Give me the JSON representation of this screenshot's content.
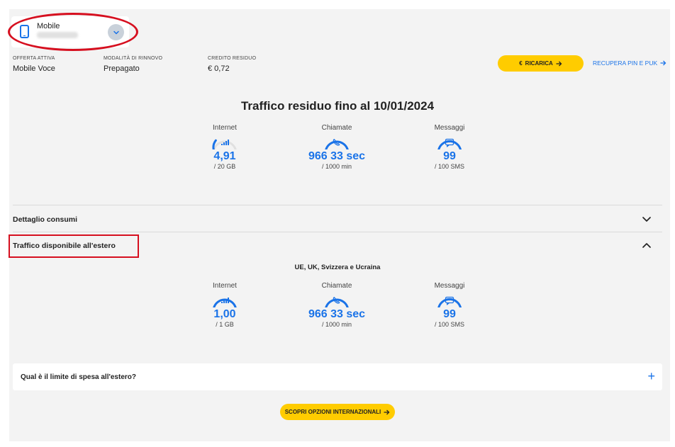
{
  "device": {
    "label": "Mobile",
    "icon": "smartphone-icon",
    "chevron_icon": "chevron-down-icon"
  },
  "summary": {
    "offer_label": "OFFERTA ATTIVA",
    "offer_value": "Mobile Voce",
    "renewal_label": "MODALITÀ DI RINNOVO",
    "renewal_value": "Prepagato",
    "credit_label": "CREDITO RESIDUO",
    "credit_value": "€ 0,72"
  },
  "actions": {
    "recharge_label": "RICARICA",
    "recharge_icon": "euro-icon",
    "recover_label": "RECUPERA PIN E PUK",
    "arrow_icon": "arrow-right-icon"
  },
  "traffic": {
    "title": "Traffico residuo fino al 10/01/2024",
    "meters": [
      {
        "label": "Internet",
        "value": "4,91",
        "unit": "/ 20 GB",
        "icon": "signal-bars-icon",
        "fraction": 0.25
      },
      {
        "label": "Chiamate",
        "value": "966 33 sec",
        "unit": "/ 1000 min",
        "icon": "phone-icon",
        "fraction": 1.0
      },
      {
        "label": "Messaggi",
        "value": "99",
        "unit": "/ 100 SMS",
        "icon": "message-icon",
        "fraction": 0.99
      }
    ]
  },
  "accordion": {
    "details_title": "Dettaglio consumi",
    "abroad_title": "Traffico disponibile all'estero",
    "collapsed_icon": "chevron-down-icon",
    "expanded_icon": "chevron-up-icon"
  },
  "abroad": {
    "region": "UE, UK, Svizzera e Ucraina",
    "meters": [
      {
        "label": "Internet",
        "value": "1,00",
        "unit": "/ 1 GB",
        "icon": "signal-bars-icon",
        "fraction": 1.0
      },
      {
        "label": "Chiamate",
        "value": "966 33 sec",
        "unit": "/ 1000 min",
        "icon": "phone-icon",
        "fraction": 1.0
      },
      {
        "label": "Messaggi",
        "value": "99",
        "unit": "/ 100 SMS",
        "icon": "message-icon",
        "fraction": 0.99
      }
    ]
  },
  "faq": {
    "question": "Qual è il limite di spesa all'estero?",
    "icon": "plus-icon"
  },
  "cta": {
    "label": "SCOPRI OPZIONI INTERNAZIONALI"
  },
  "colors": {
    "accent": "#1a73e8",
    "button": "#ffcc00",
    "highlight": "#d60f1f",
    "track": "#e0e0e0"
  }
}
